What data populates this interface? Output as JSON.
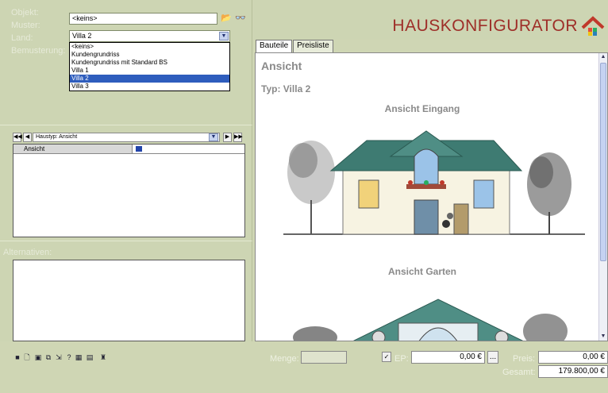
{
  "form": {
    "objekt_label": "Objekt:",
    "objekt_value": "<keins>",
    "muster_label": "Muster:",
    "muster_value": "Villa 2",
    "land_label": "Land:",
    "bemusterung_label": "Bemusterung:",
    "muster_options": [
      "<keins>",
      "Kundengrundriss",
      "Kundengrundriss mit Standard BS",
      "Villa 1",
      "Villa 2",
      "Villa 3"
    ],
    "muster_selected_index": 4
  },
  "nav": {
    "selector_value": "Haustyp: Ansicht",
    "first_icon": "first-record-icon",
    "prev_icon": "prev-record-icon",
    "next_icon": "next-record-icon",
    "last_icon": "last-record-icon"
  },
  "grid": {
    "column_header": "Ansicht"
  },
  "alternatives": {
    "label": "Alternativen:"
  },
  "header": {
    "app_title": "HAUSKONFIGURATOR",
    "logo_icon": "house-logo-icon"
  },
  "tabs": [
    {
      "label": "Bauteile",
      "active": true
    },
    {
      "label": "Preisliste",
      "active": false
    }
  ],
  "content": {
    "title": "Ansicht",
    "type_line": "Typ: Villa 2",
    "caption_entrance": "Ansicht Eingang",
    "caption_garden": "Ansicht Garten"
  },
  "footer": {
    "menge_label": "Menge:",
    "menge_value": "",
    "ep_label": "EP:",
    "ep_value": "0,00 €",
    "ep_picker": "...",
    "preis_label": "Preis:",
    "preis_value": "0,00 €",
    "gesamt_label": "Gesamt:",
    "gesamt_value": "179.800,00 €"
  },
  "colors": {
    "panel": "#cdd5b3",
    "title": "#9e2e28",
    "selection": "#2e5dbd"
  }
}
